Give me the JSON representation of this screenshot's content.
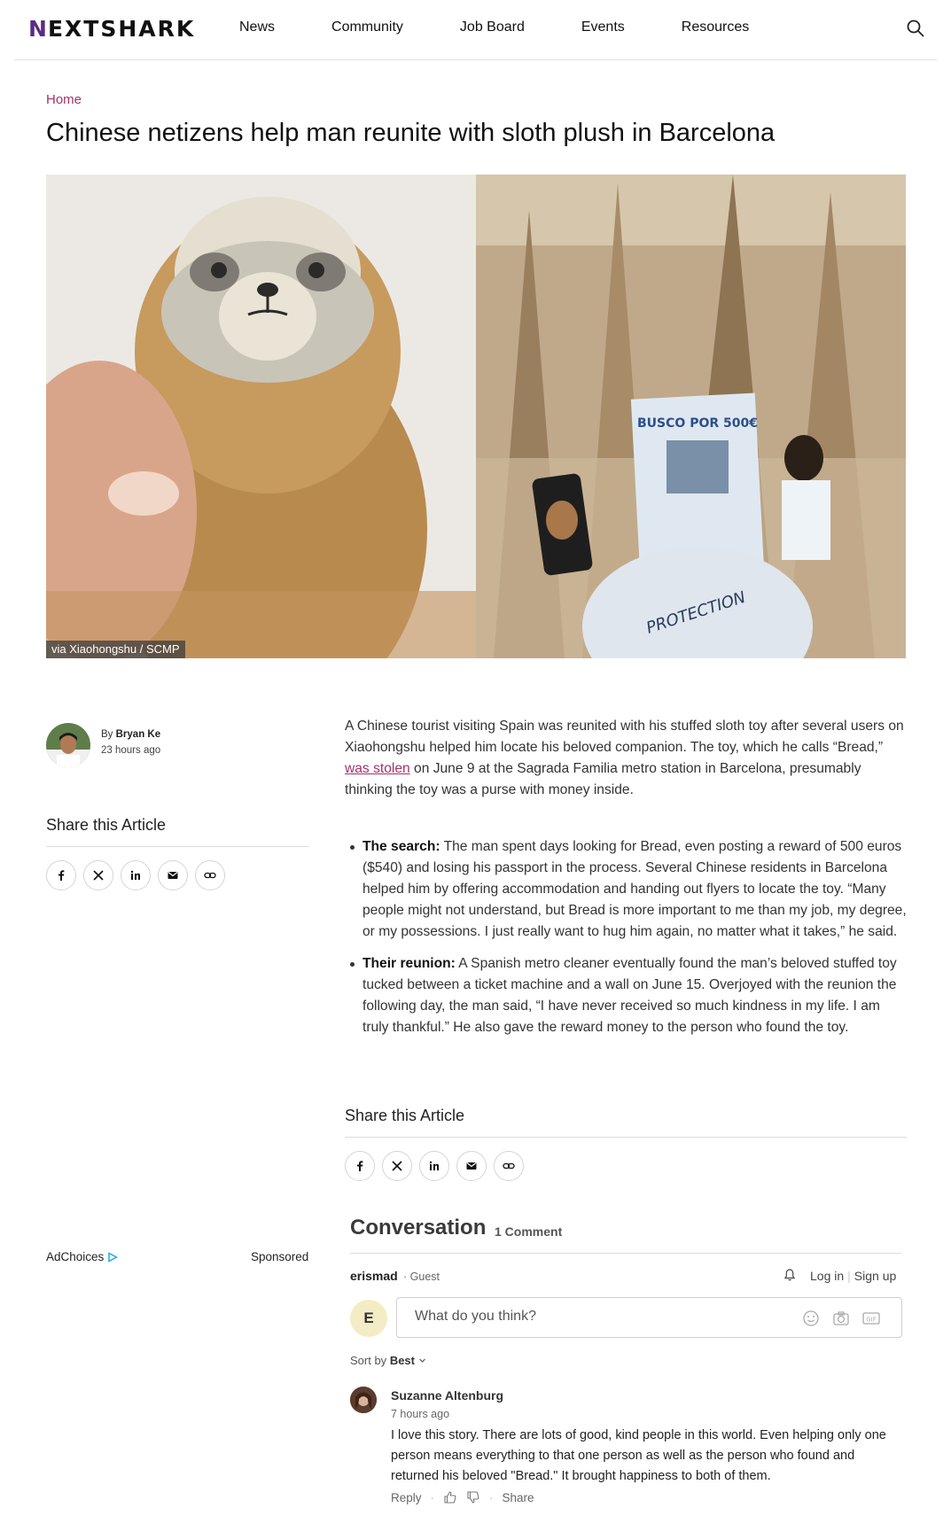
{
  "header": {
    "logo_first": "N",
    "logo_rest": "EXTSHARK",
    "nav": [
      "News",
      "Community",
      "Job Board",
      "Events",
      "Resources"
    ]
  },
  "article": {
    "breadcrumb": "Home",
    "title": "Chinese netizens help man reunite with sloth plush in Barcelona",
    "image_credit": "via Xiaohongshu / SCMP",
    "image_poster_text": "BUSCO POR 500€",
    "image_shirt_text": "PROTECTION",
    "author_prefix": "By",
    "author": "Bryan Ke",
    "published": "23 hours ago",
    "intro_before_link": "A Chinese tourist visiting Spain was reunited with his stuffed sloth toy after several users on Xiaohongshu helped him locate his beloved companion. The toy, which he calls “Bread,” ",
    "intro_link": "was stolen",
    "intro_after_link": " on June 9 at the Sagrada Familia metro station in Barcelona, presumably thinking the toy was a purse with money inside.",
    "bullets": [
      {
        "label": "The search:",
        "text": " The man spent days looking for Bread, even posting a reward of 500 euros ($540) and losing his passport in the process. Several Chinese residents in Barcelona helped him by offering accommodation and handing out flyers to locate the toy. “Many people might not understand, but Bread is more important to me than my job, my degree, or my possessions. I just really want to hug him again, no matter what it takes,” he said."
      },
      {
        "label": "Their reunion:",
        "text": " A Spanish metro cleaner eventually found the man’s beloved stuffed toy tucked between a ticket machine and a wall on June 15. Overjoyed with the reunion the following day, the man said, “I have never received so much kindness in my life. I am truly thankful.” He also gave the reward money to the person who found the toy."
      }
    ]
  },
  "share": {
    "title": "Share this Article",
    "buttons": [
      "facebook-icon",
      "x-icon",
      "linkedin-icon",
      "mail-icon",
      "link-icon"
    ]
  },
  "ad": {
    "adchoices": "AdChoices",
    "sponsored": "Sponsored"
  },
  "conversation": {
    "title": "Conversation",
    "count": "1 Comment",
    "username": "erismad",
    "role": "Guest",
    "login": "Log in",
    "signup": "Sign up",
    "user_initial": "E",
    "input_placeholder": "What do you think?",
    "sort_label": "Sort by",
    "sort_value": "Best",
    "comments": [
      {
        "author": "Suzanne Altenburg",
        "time": "7 hours ago",
        "text": "I love this story. There are lots of good, kind people in this world. Even helping only one person means everything to that one person as well as the person who found and returned his beloved \"Bread.\"  It brought happiness to both of them.",
        "reply": "Reply",
        "share": "Share"
      }
    ]
  },
  "colors": {
    "brand_purple": "#5b2a86",
    "link": "#a3336b"
  }
}
